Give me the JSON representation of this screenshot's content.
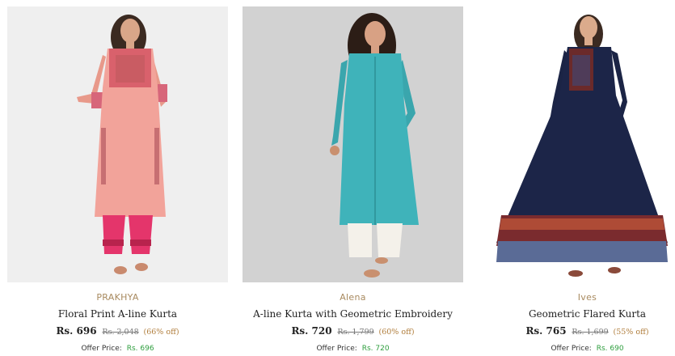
{
  "products": [
    {
      "brand": "PRAKHYA",
      "name": "Floral Print A-line Kurta",
      "price": "Rs. 696",
      "mrp": "Rs. 2,048",
      "discount": "(66% off)",
      "offer_label": "Offer Price:",
      "offer_price": "Rs. 696",
      "image_icon": "product-photo-pink-kurta"
    },
    {
      "brand": "Alena",
      "name": "A-line Kurta with Geometric Embroidery",
      "price": "Rs. 720",
      "mrp": "Rs. 1,799",
      "discount": "(60% off)",
      "offer_label": "Offer Price:",
      "offer_price": "Rs. 720",
      "image_icon": "product-photo-teal-kurta"
    },
    {
      "brand": "Ives",
      "name": "Geometric Flared Kurta",
      "price": "Rs. 765",
      "mrp": "Rs. 1,699",
      "discount": "(55% off)",
      "offer_label": "Offer Price:",
      "offer_price": "Rs. 690",
      "image_icon": "product-photo-navy-kurta"
    }
  ],
  "colors": {
    "brand": "#a88a5f",
    "offer_price": "#2e9e3e",
    "discount": "#b07d3b",
    "bg1": "#eeeeee",
    "bg2": "#cfcfcf",
    "bg3": "#ffffff"
  }
}
